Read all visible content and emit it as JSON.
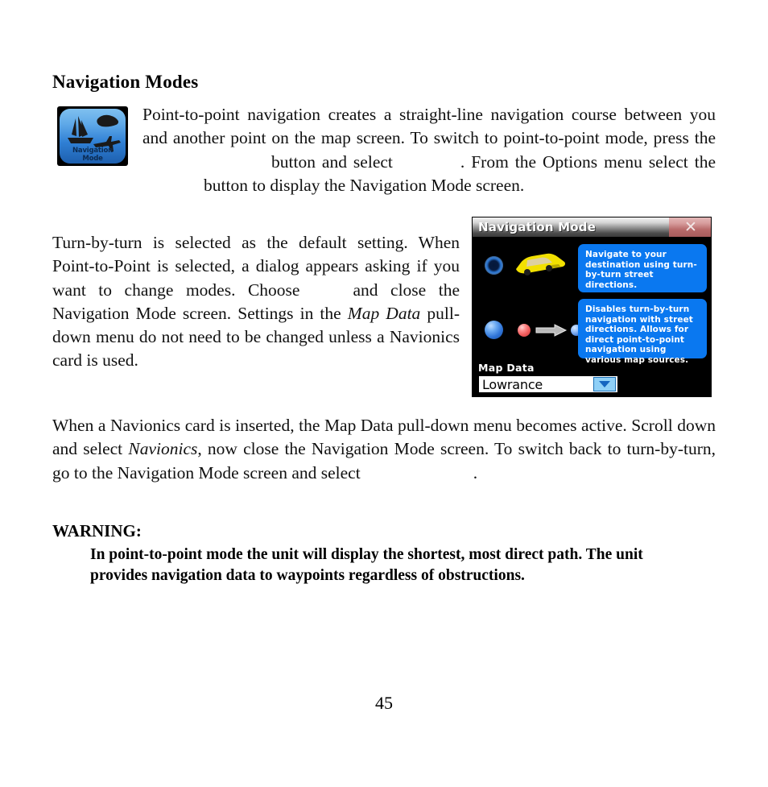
{
  "page": {
    "number": "45",
    "heading": "Navigation Modes"
  },
  "icon": {
    "name": "navigation-mode-icon",
    "label_line1": "Navigation",
    "label_line2": "Mode"
  },
  "paragraphs": {
    "p1_a": "Point-to-point navigation creates a straight-line navigation course between you and another point on the map screen. To switch to point-to-point mode, press the",
    "p1_b": "button and select",
    "p1_c": ". From the Options menu select the",
    "p1_d": "button to display the Navigation Mode screen.",
    "p2_a": "Turn-by-turn is selected as the default setting. When Point-to-Point is selected, a dialog appears asking if you want to change modes. Choose",
    "p2_b": "and close the Navigation Mode screen. Settings in the",
    "p2_italic": "Map Data",
    "p2_c": "pull-down menu do not need to be changed unless a Navionics card is used.",
    "p3_a": "When a Navionics card is inserted, the Map Data pull-down menu becomes active. Scroll down and select",
    "p3_italic": "Navionics",
    "p3_b": ", now close the Navigation Mode screen. To switch back to turn-by-turn, go to the Navigation Mode screen and select",
    "p3_c": "."
  },
  "warning": {
    "label": "WARNING:",
    "body": "In point-to-point mode the unit will display the shortest, most direct path. The unit provides navigation data to waypoints regardless of obstructions."
  },
  "device_screen": {
    "title": "Navigation Mode",
    "close_glyph": "✕",
    "option_turn_by_turn": {
      "selected": true,
      "description": "Navigate to your destination using turn-by-turn street directions."
    },
    "option_point_to_point": {
      "selected": false,
      "description": "Disables turn-by-turn navigation with street directions. Allows for direct point-to-point navigation using various map sources."
    },
    "map_data": {
      "label": "Map Data",
      "value": "Lowrance"
    },
    "colors": {
      "info_box_blue": "#0a78f0",
      "close_button_red": "#b86a6a",
      "background": "#000000",
      "car_yellow": "#f2e000"
    }
  }
}
